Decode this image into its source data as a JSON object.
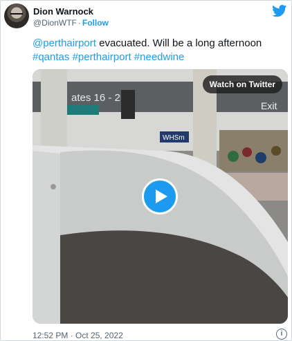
{
  "tweet": {
    "author_name": "Dion Warnock",
    "handle": "@DionWTF",
    "separator": "·",
    "follow_label": "Follow",
    "text_mention": "@perthairport",
    "text_body": " evacuated. Will be a long afternoon",
    "hashtags": [
      "#qantas",
      "#perthairport",
      "#needwine"
    ],
    "timestamp": "12:52 PM · Oct 25, 2022",
    "info_glyph": "i"
  },
  "video": {
    "watch_label": "Watch on Twitter",
    "scene_signs": [
      "ates 16 - 25",
      "Exit",
      "WHSm"
    ]
  },
  "colors": {
    "accent": "#1d9bf0",
    "text": "#0f1419",
    "secondary": "#536471",
    "border": "#cfd9de"
  }
}
